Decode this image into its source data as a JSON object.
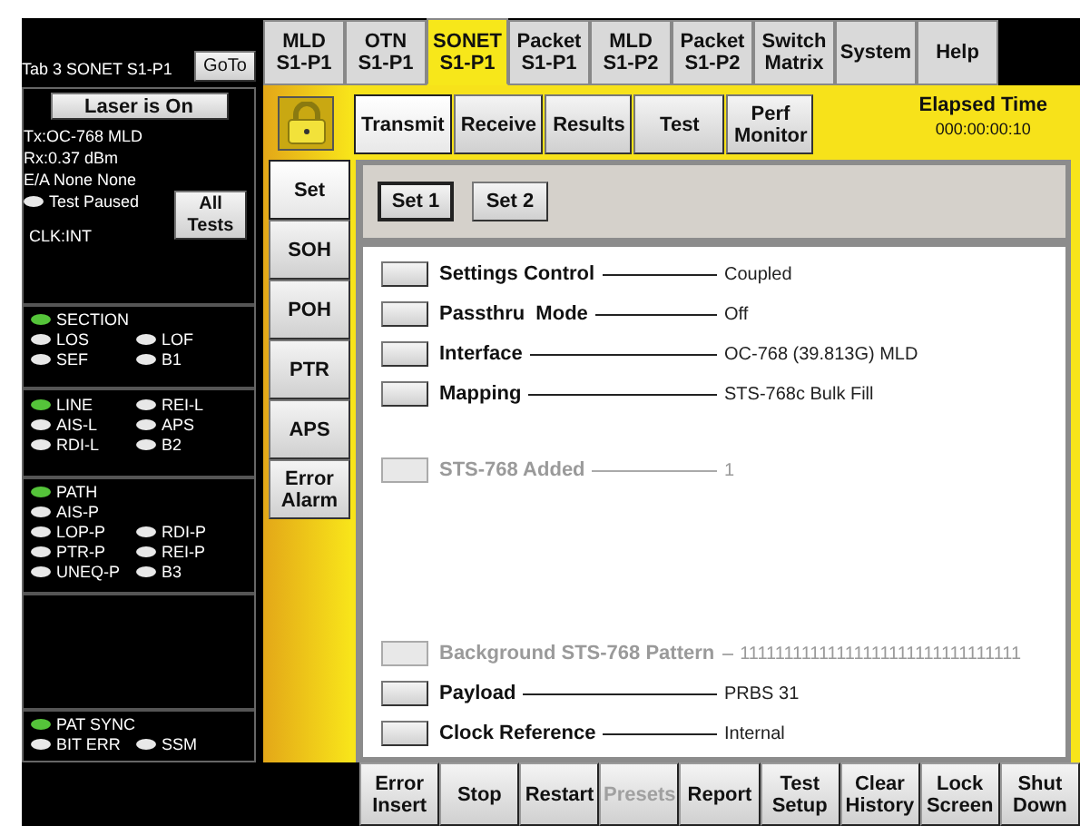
{
  "port_label": "Tab 3 SONET S1-P1",
  "goto_button": "GoTo",
  "tabs": [
    {
      "label": "MLD\nS1-P1",
      "selected": false
    },
    {
      "label": "OTN\nS1-P1",
      "selected": false
    },
    {
      "label": "SONET\nS1-P1",
      "selected": true
    },
    {
      "label": "Packet\nS1-P1",
      "selected": false
    },
    {
      "label": "MLD\nS1-P2",
      "selected": false
    },
    {
      "label": "Packet\nS1-P2",
      "selected": false
    },
    {
      "label": "Switch\nMatrix",
      "selected": false
    },
    {
      "label": "System",
      "selected": false
    },
    {
      "label": "Help",
      "selected": false
    }
  ],
  "status_panel": {
    "laser_button": "Laser is On",
    "tx": "Tx:OC-768 MLD",
    "rx": "Rx:0.37 dBm",
    "ea": "E/A None None",
    "test_state": {
      "label": "Test Paused",
      "on": false
    },
    "clock": "CLK:INT",
    "all_tests_button": "All\nTests",
    "led_groups": [
      {
        "rows": [
          [
            {
              "label": "SECTION",
              "on": true
            }
          ],
          [
            {
              "label": "LOS",
              "on": false
            },
            {
              "label": "LOF",
              "on": false
            }
          ],
          [
            {
              "label": "SEF",
              "on": false
            },
            {
              "label": "B1",
              "on": false
            }
          ]
        ]
      },
      {
        "rows": [
          [
            {
              "label": "LINE",
              "on": true
            },
            {
              "label": "REI-L",
              "on": false
            }
          ],
          [
            {
              "label": "AIS-L",
              "on": false
            },
            {
              "label": "APS",
              "on": false
            }
          ],
          [
            {
              "label": "RDI-L",
              "on": false
            },
            {
              "label": "B2",
              "on": false
            }
          ]
        ]
      },
      {
        "rows": [
          [
            {
              "label": "PATH",
              "on": true
            }
          ],
          [
            {
              "label": "AIS-P",
              "on": false
            }
          ],
          [
            {
              "label": "LOP-P",
              "on": false
            },
            {
              "label": "RDI-P",
              "on": false
            }
          ],
          [
            {
              "label": "PTR-P",
              "on": false
            },
            {
              "label": "REI-P",
              "on": false
            }
          ],
          [
            {
              "label": "UNEQ-P",
              "on": false
            },
            {
              "label": "B3",
              "on": false
            }
          ]
        ]
      },
      {
        "rows": [
          [
            {
              "label": "PAT SYNC",
              "on": true
            }
          ],
          [
            {
              "label": "BIT ERR",
              "on": false
            },
            {
              "label": "SSM",
              "on": false
            }
          ]
        ]
      }
    ]
  },
  "subtabs": [
    {
      "label": "Transmit",
      "selected": true
    },
    {
      "label": "Receive",
      "selected": false
    },
    {
      "label": "Results",
      "selected": false
    },
    {
      "label": "Test",
      "selected": false
    },
    {
      "label": "Perf\nMonitor",
      "selected": false
    }
  ],
  "elapsed": {
    "label": "Elapsed Time",
    "value": "000:00:00:10"
  },
  "side_tabs": [
    {
      "label": "Set",
      "selected": true
    },
    {
      "label": "SOH",
      "selected": false
    },
    {
      "label": "POH",
      "selected": false
    },
    {
      "label": "PTR",
      "selected": false
    },
    {
      "label": "APS",
      "selected": false
    },
    {
      "label": "Error\nAlarm",
      "selected": false
    }
  ],
  "set_buttons": [
    {
      "label": "Set 1",
      "selected": true
    },
    {
      "label": "Set 2",
      "selected": false
    }
  ],
  "setting_groups": [
    [
      {
        "label": "Settings Control",
        "value": "Coupled",
        "disabled": false
      },
      {
        "label": "Passthru  Mode",
        "value": "Off",
        "disabled": false
      },
      {
        "label": "Interface",
        "value": "OC-768 (39.813G) MLD",
        "disabled": false
      },
      {
        "label": "Mapping",
        "value": "STS-768c Bulk Fill",
        "disabled": false
      }
    ],
    [
      {
        "label": "STS-768 Added",
        "value": "1",
        "disabled": true
      }
    ],
    [
      {
        "label": "Background STS-768 Pattern",
        "value": "11111111111111111111111111111111",
        "disabled": true
      },
      {
        "label": "Payload",
        "value": "PRBS 31",
        "disabled": false
      },
      {
        "label": "Clock Reference",
        "value": "Internal",
        "disabled": false
      }
    ]
  ],
  "bottom_buttons": [
    {
      "label": "Error\nInsert",
      "disabled": false
    },
    {
      "label": "Stop",
      "disabled": false
    },
    {
      "label": "Restart",
      "disabled": false
    },
    {
      "label": "Presets",
      "disabled": true
    },
    {
      "label": "Report",
      "disabled": false
    },
    {
      "label": "Test\nSetup",
      "disabled": false
    },
    {
      "label": "Clear\nHistory",
      "disabled": false
    },
    {
      "label": "Lock\nScreen",
      "disabled": false
    },
    {
      "label": "Shut\nDown",
      "disabled": false
    }
  ]
}
